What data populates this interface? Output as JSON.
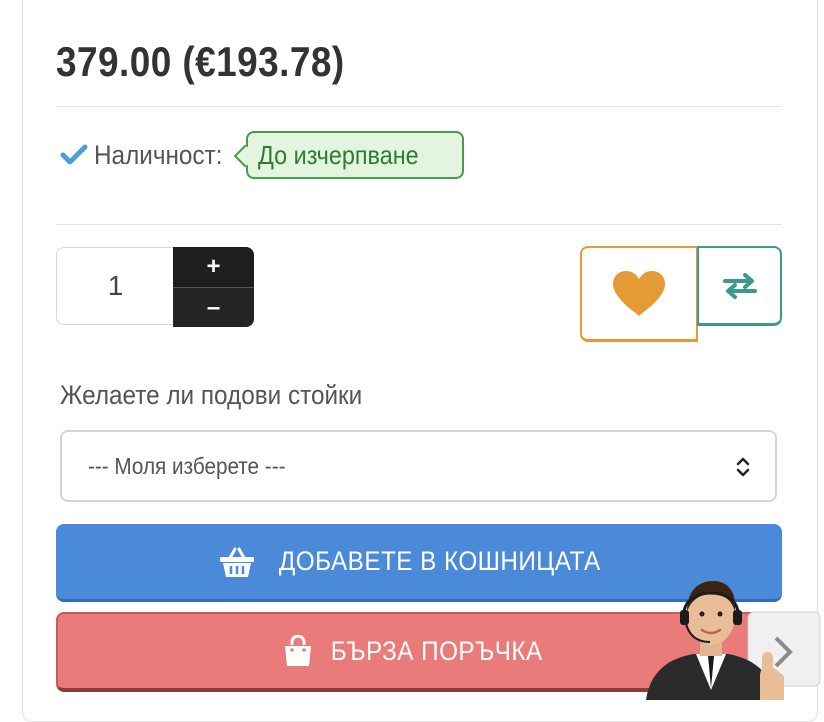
{
  "product": {
    "price": "379.00 (€193.78)",
    "availability_label": "Наличност:",
    "availability_value": "До изчерпване"
  },
  "quantity": {
    "value": "1",
    "plus_label": "+",
    "minus_label": "–"
  },
  "actions": {
    "wishlist_icon": "heart-icon",
    "compare_icon": "swap-arrows-icon"
  },
  "option": {
    "label": "Желаете ли подови стойки",
    "selected": "--- Моля изберете ---"
  },
  "buttons": {
    "add_to_cart": "ДОБАВЕТЕ В КОШНИЦАТА",
    "quick_order": "БЪРЗА ПОРЪЧКА"
  },
  "colors": {
    "cart_blue": "#4a8ad8",
    "quick_red": "#ea7b7b",
    "wishlist_orange": "#e49a35",
    "compare_teal": "#3b9a8a",
    "stock_green": "#2e7d32",
    "check_blue": "#4a9fd8"
  }
}
